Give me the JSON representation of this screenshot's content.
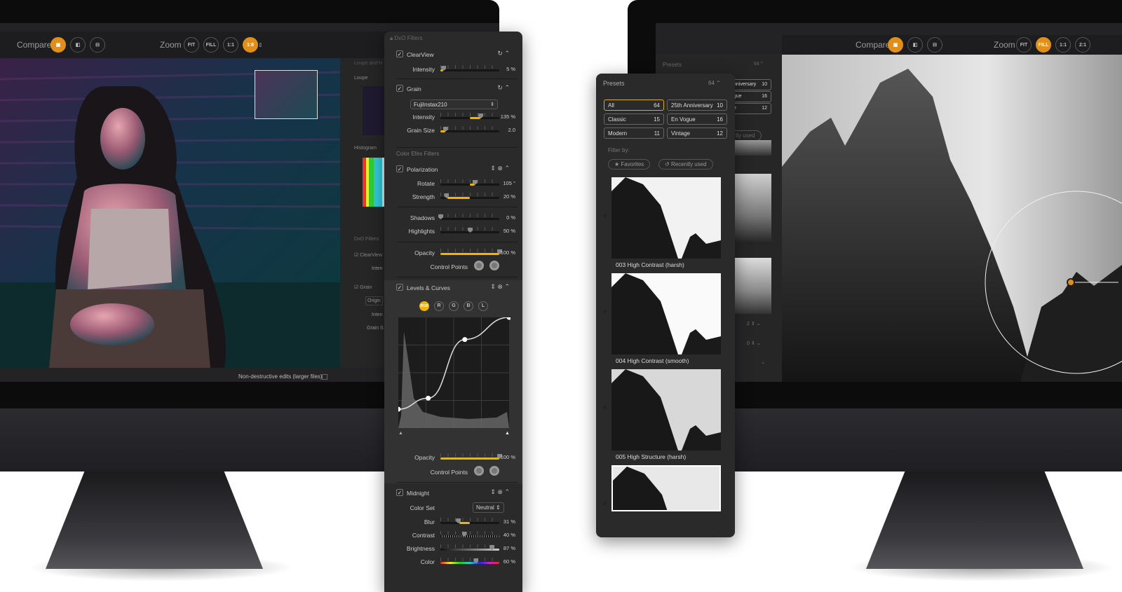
{
  "left_app": {
    "toolbar": {
      "compare_label": "Compare",
      "compare_buttons": [
        {
          "icon": "compare-side-icon",
          "active": true
        },
        {
          "icon": "compare-split-icon",
          "active": false
        },
        {
          "icon": "compare-stack-icon",
          "active": false
        }
      ],
      "zoom_label": "Zoom",
      "zoom_buttons": [
        {
          "label": "FIT",
          "active": false
        },
        {
          "label": "FILL",
          "active": false
        },
        {
          "label": "1:1",
          "active": false
        },
        {
          "label": "1:8",
          "active": true
        }
      ]
    },
    "side_panel": {
      "section": "Loupe and H",
      "loupe": "Loupe",
      "histogram": "Histogram",
      "dxo": "DxO Filters",
      "clearview": "ClearView",
      "intensity": "Inten",
      "grain": "Grain",
      "grain_preset": "Origin",
      "intensity2": "Inten",
      "grain_size": "Grain S"
    },
    "footer_text": "Non-destructive edits (larger files)"
  },
  "filters": {
    "title": "DxO Filters",
    "clearview": {
      "name": "ClearView",
      "checked": true,
      "sliders": [
        {
          "label": "Intensity",
          "value": "5 %",
          "pos": 0.05,
          "fill": [
            0,
            0.05
          ]
        }
      ]
    },
    "grain": {
      "name": "Grain",
      "checked": true,
      "preset": "FujiInstax210",
      "sliders": [
        {
          "label": "Intensity",
          "value": "135 %",
          "pos": 0.68,
          "fill": [
            0.5,
            0.68
          ]
        },
        {
          "label": "Grain Size",
          "value": "2.0",
          "pos": 0.08,
          "fill": [
            0,
            0.08
          ]
        }
      ]
    },
    "section_color_efex": "Color Efex Filters",
    "polarization": {
      "name": "Polarization",
      "checked": true,
      "sliders": [
        {
          "label": "Rotate",
          "value": "105 °",
          "pos": 0.58,
          "fill": [
            0.5,
            0.58
          ]
        },
        {
          "label": "Strength",
          "value": "20 %",
          "pos": 0.1,
          "fill": [
            0.12,
            0.5
          ]
        },
        {
          "label": "Shadows",
          "value": "0 %",
          "pos": 0,
          "fill": [
            0,
            0
          ]
        },
        {
          "label": "Highlights",
          "value": "50 %",
          "pos": 0.5,
          "fill": [
            0,
            0
          ]
        },
        {
          "label": "Opacity",
          "value": "100 %",
          "pos": 1,
          "fill": [
            0,
            1
          ]
        }
      ],
      "control_points": "Control Points"
    },
    "levels_curves": {
      "name": "Levels & Curves",
      "checked": true,
      "channels": [
        "RGB",
        "R",
        "G",
        "B",
        "L"
      ],
      "active_channel": "RGB",
      "curve_points": [
        [
          0,
          0.17
        ],
        [
          0.27,
          0.27
        ],
        [
          0.6,
          0.8
        ],
        [
          1,
          1
        ]
      ],
      "sliders": [
        {
          "label": "Opacity",
          "value": "100 %",
          "pos": 1,
          "fill": [
            0,
            1
          ]
        }
      ],
      "control_points": "Control Points"
    },
    "midnight": {
      "name": "Midnight",
      "checked": true,
      "color_set_label": "Color Set",
      "color_set": "Neutral",
      "sliders": [
        {
          "label": "Blur",
          "value": "31 %",
          "pos": 0.3,
          "fill": [
            0.32,
            0.5
          ]
        },
        {
          "label": "Contrast",
          "value": "40 %",
          "pos": 0.4,
          "fill": [
            0,
            0
          ],
          "track": "checker"
        },
        {
          "label": "Brightness",
          "value": "87 %",
          "pos": 0.87,
          "fill": [
            0,
            0
          ],
          "track": "gray"
        },
        {
          "label": "Color",
          "value": "60 %",
          "pos": 0.6,
          "fill": [
            0,
            0
          ],
          "track": "rainbow"
        }
      ]
    }
  },
  "presets": {
    "title": "Presets",
    "count": "64",
    "categories": [
      {
        "name": "All",
        "count": "64",
        "active": true
      },
      {
        "name": "25th Anniversary",
        "count": "10"
      },
      {
        "name": "Classic",
        "count": "15"
      },
      {
        "name": "En Vogue",
        "count": "16"
      },
      {
        "name": "Modern",
        "count": "11"
      },
      {
        "name": "Vintage",
        "count": "12"
      }
    ],
    "filter_by": "Filter by:",
    "filters": [
      {
        "icon": "star-icon",
        "label": "Favorites"
      },
      {
        "icon": "history-icon",
        "label": "Recently used"
      }
    ],
    "items": [
      {
        "label": "003 High Contrast (harsh)"
      },
      {
        "label": "004 High Contrast (smooth)"
      },
      {
        "label": "005 High Structure (harsh)"
      },
      {
        "label": ""
      }
    ]
  },
  "right_app": {
    "toolbar": {
      "compare_label": "Compare",
      "zoom_label": "Zoom",
      "zoom_buttons": [
        {
          "label": "FIT",
          "active": false
        },
        {
          "label": "FILL",
          "active": true
        },
        {
          "label": "1:1",
          "active": false
        },
        {
          "label": "2:1",
          "active": false
        }
      ]
    },
    "back_panel": {
      "title": "Presets",
      "count": "64",
      "rows": [
        {
          "name": "nniversary",
          "count": "10"
        },
        {
          "name": "gue",
          "count": "16"
        },
        {
          "name": "e",
          "count": "12"
        }
      ],
      "recent": "tly used",
      "counts": [
        "2",
        "0"
      ]
    }
  },
  "colors": {
    "accent": "#e0901a",
    "slider_fill": "#f2b400",
    "panel_bg": "#2a2a2b"
  }
}
